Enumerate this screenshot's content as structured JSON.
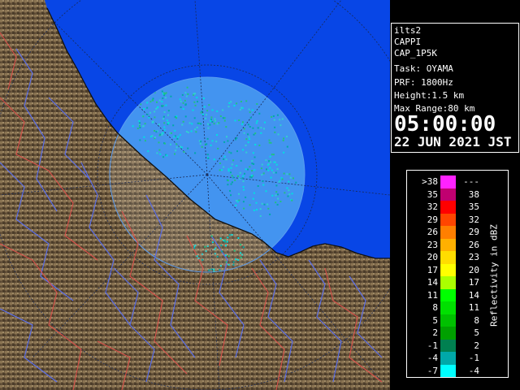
{
  "info_panel": {
    "lines": [
      "ilts2",
      "CAPPI",
      "CAP_1P5K",
      "Task: OYAMA",
      "PRF: 1800Hz",
      "Height:1.5 km",
      "Max Range:80 km"
    ],
    "time": "05:00:00",
    "date": "22 JUN 2021 JST"
  },
  "legend": {
    "title": "Reflectivity in dBZ",
    "rows": [
      {
        "lo": ">38",
        "hi": "---",
        "color": "#ff22ff"
      },
      {
        "lo": "35",
        "hi": "38",
        "color": "#c00070"
      },
      {
        "lo": "32",
        "hi": "35",
        "color": "#ff0000"
      },
      {
        "lo": "29",
        "hi": "32",
        "color": "#ff4500"
      },
      {
        "lo": "26",
        "hi": "29",
        "color": "#ff7f00"
      },
      {
        "lo": "23",
        "hi": "26",
        "color": "#ffb000"
      },
      {
        "lo": "20",
        "hi": "23",
        "color": "#ffdd00"
      },
      {
        "lo": "17",
        "hi": "20",
        "color": "#ffff00"
      },
      {
        "lo": "14",
        "hi": "17",
        "color": "#aaff00"
      },
      {
        "lo": "11",
        "hi": "14",
        "color": "#00ff00"
      },
      {
        "lo": "8",
        "hi": "11",
        "color": "#00e000"
      },
      {
        "lo": "5",
        "hi": "8",
        "color": "#00c000"
      },
      {
        "lo": "2",
        "hi": "5",
        "color": "#00a000"
      },
      {
        "lo": "-1",
        "hi": "2",
        "color": "#008050"
      },
      {
        "lo": "-4",
        "hi": "-1",
        "color": "#00a8a8"
      },
      {
        "lo": "-7",
        "hi": "-4",
        "color": "#00ffff"
      }
    ]
  },
  "map": {
    "sea_color": "#0846e6",
    "coverage_color": "#2a86ee",
    "land_color": "#6e5a40"
  }
}
